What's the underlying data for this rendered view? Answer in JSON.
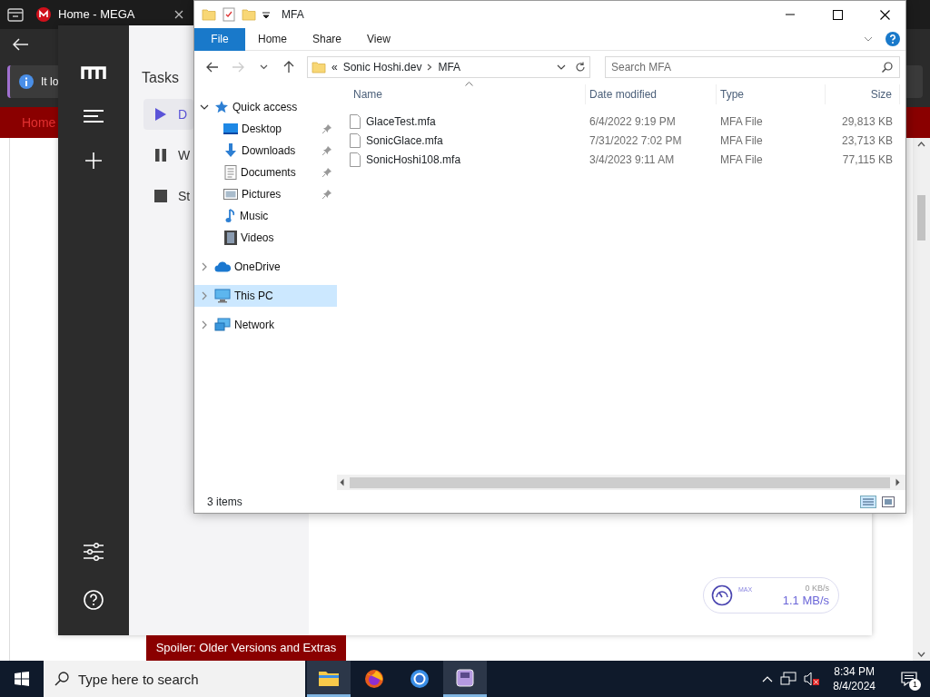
{
  "browser": {
    "tab_title": "Home - MEGA",
    "info_text": "It lo",
    "nav_link": "Home"
  },
  "mega": {
    "heading": "Tasks",
    "tasks": [
      {
        "kind": "play",
        "label": "D",
        "selected": true
      },
      {
        "kind": "pause",
        "label": "W",
        "selected": false
      },
      {
        "kind": "stop",
        "label": "St",
        "selected": false
      }
    ],
    "speed": {
      "max_label": "MAX",
      "upload": "0 KB/s",
      "download": "1.1 MB/s"
    }
  },
  "spoiler": {
    "label": "Spoiler: Older Versions and Extras"
  },
  "explorer": {
    "title": "MFA",
    "ribbon_tabs": [
      {
        "label": "File",
        "selected": true
      },
      {
        "label": "Home",
        "selected": false
      },
      {
        "label": "Share",
        "selected": false
      },
      {
        "label": "View",
        "selected": false
      }
    ],
    "address": {
      "overflow": "«",
      "path": [
        "Sonic Hoshi.dev",
        "MFA"
      ]
    },
    "search": {
      "placeholder": "Search MFA"
    },
    "nav": [
      {
        "kind": "star",
        "label": "Quick access",
        "expanded": true,
        "selected": false,
        "children": [
          {
            "kind": "desktop",
            "label": "Desktop",
            "pinned": true,
            "selected": false
          },
          {
            "kind": "downloads",
            "label": "Downloads",
            "pinned": true,
            "selected": false
          },
          {
            "kind": "documents",
            "label": "Documents",
            "pinned": true,
            "selected": false
          },
          {
            "kind": "pictures",
            "label": "Pictures",
            "pinned": true,
            "selected": false
          },
          {
            "kind": "music",
            "label": "Music",
            "pinned": false,
            "selected": false
          },
          {
            "kind": "videos",
            "label": "Videos",
            "pinned": false,
            "selected": false
          }
        ]
      },
      {
        "kind": "cloud",
        "label": "OneDrive",
        "expanded": false,
        "selected": false
      },
      {
        "kind": "pc",
        "label": "This PC",
        "expanded": false,
        "selected": true
      },
      {
        "kind": "network",
        "label": "Network",
        "expanded": false,
        "selected": false
      }
    ],
    "columns": [
      "Name",
      "Date modified",
      "Type",
      "Size"
    ],
    "files": [
      {
        "name": "GlaceTest.mfa",
        "date": "6/4/2022 9:19 PM",
        "type": "MFA File",
        "size": "29,813 KB"
      },
      {
        "name": "SonicGlace.mfa",
        "date": "7/31/2022 7:02 PM",
        "type": "MFA File",
        "size": "23,713 KB"
      },
      {
        "name": "SonicHoshi108.mfa",
        "date": "3/4/2023 9:11 AM",
        "type": "MFA File",
        "size": "77,115 KB"
      }
    ],
    "status": "3 items"
  },
  "taskbar": {
    "search_placeholder": "Type here to search",
    "time": "8:34 PM",
    "date": "8/4/2024",
    "notification_count": "1"
  }
}
